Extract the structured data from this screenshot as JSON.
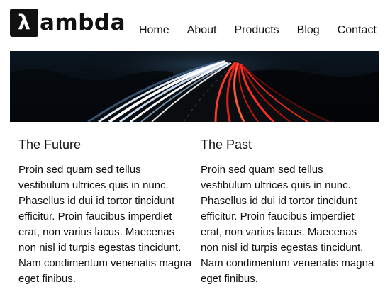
{
  "header": {
    "logo_mark": "λ",
    "logo_text": "ambda",
    "nav": [
      {
        "label": "Home"
      },
      {
        "label": "About"
      },
      {
        "label": "Products"
      },
      {
        "label": "Blog"
      },
      {
        "label": "Contact"
      }
    ]
  },
  "hero": {
    "image": "highway-light-trails-night"
  },
  "columns": [
    {
      "title": "The Future",
      "body": "Proin sed quam sed tellus vestibulum ultrices quis in nunc. Phasellus id dui id tortor tincidunt efficitur. Proin faucibus imperdiet erat, non varius lacus. Maecenas non nisl id turpis egestas tincidunt. Nam condimentum venenatis magna eget finibus."
    },
    {
      "title": "The Past",
      "body": "Proin sed quam sed tellus vestibulum ultrices quis in nunc. Phasellus id dui id tortor tincidunt efficitur. Proin faucibus imperdiet erat, non varius lacus. Maecenas non nisl id turpis egestas tincidunt. Nam condimentum venenatis magna eget finibus."
    }
  ]
}
